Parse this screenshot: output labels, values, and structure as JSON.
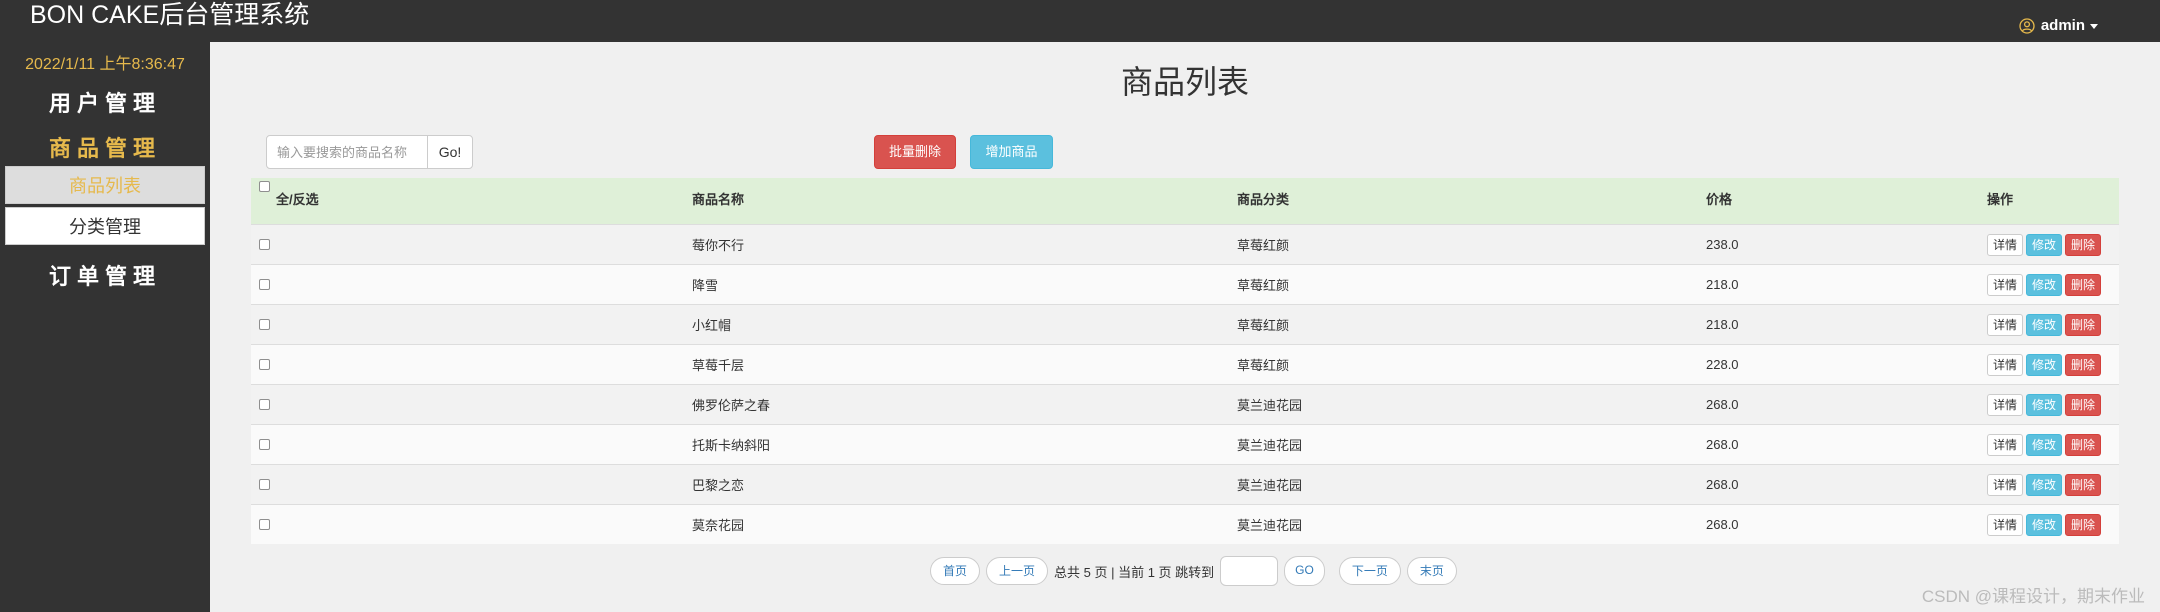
{
  "header": {
    "brand": "BON CAKE后台管理系统",
    "user": "admin"
  },
  "sidebar": {
    "datetime": "2022/1/11 上午8:36:47",
    "sections": [
      {
        "label": "用户管理"
      },
      {
        "label": "商品管理",
        "items": [
          {
            "label": "商品列表"
          },
          {
            "label": "分类管理"
          }
        ]
      },
      {
        "label": "订单管理"
      }
    ]
  },
  "main": {
    "title": "商品列表",
    "search_placeholder": "输入要搜索的商品名称",
    "go_label": "Go!",
    "batch_delete_label": "批量删除",
    "add_label": "增加商品"
  },
  "table": {
    "headers": {
      "check": "全/反选",
      "name": "商品名称",
      "category": "商品分类",
      "price": "价格",
      "ops": "操作"
    },
    "ops": {
      "detail": "详情",
      "edit": "修改",
      "delete": "删除"
    },
    "rows": [
      {
        "name": "莓你不行",
        "category": "草莓红颜",
        "price": "238.0"
      },
      {
        "name": "降雪",
        "category": "草莓红颜",
        "price": "218.0"
      },
      {
        "name": "小红帽",
        "category": "草莓红颜",
        "price": "218.0"
      },
      {
        "name": "草莓千层",
        "category": "草莓红颜",
        "price": "228.0"
      },
      {
        "name": "佛罗伦萨之春",
        "category": "莫兰迪花园",
        "price": "268.0"
      },
      {
        "name": "托斯卡纳斜阳",
        "category": "莫兰迪花园",
        "price": "268.0"
      },
      {
        "name": "巴黎之恋",
        "category": "莫兰迪花园",
        "price": "268.0"
      },
      {
        "name": "莫奈花园",
        "category": "莫兰迪花园",
        "price": "268.0"
      }
    ]
  },
  "pager": {
    "first": "首页",
    "prev": "上一页",
    "info": "总共 5 页 | 当前 1 页 跳转到",
    "go": "GO",
    "next": "下一页",
    "last": "末页"
  },
  "watermark": "CSDN @课程设计，期末作业",
  "colors": {
    "accent": "#e6b94c",
    "dark": "#333333",
    "danger": "#d9534f",
    "info": "#5bc0de",
    "header_row": "#dff0d8"
  }
}
